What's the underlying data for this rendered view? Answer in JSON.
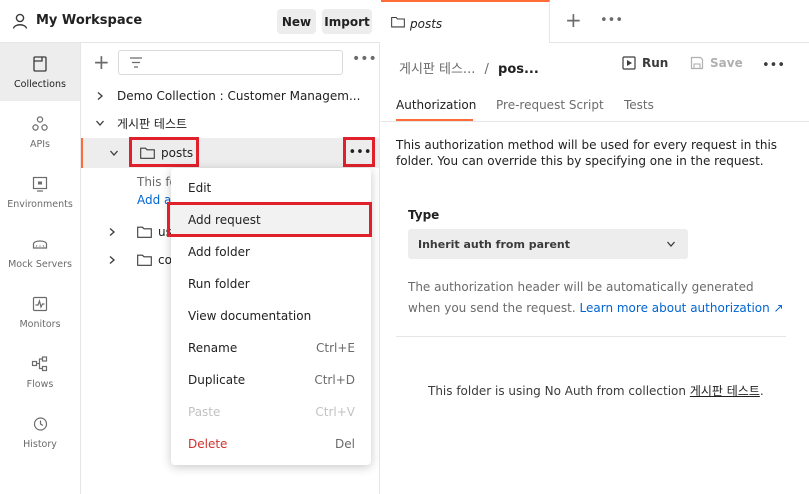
{
  "workspace": {
    "title": "My Workspace",
    "new_label": "New",
    "import_label": "Import"
  },
  "rail": {
    "items": [
      {
        "label": "Collections",
        "icon": "collections-icon"
      },
      {
        "label": "APIs",
        "icon": "apis-icon"
      },
      {
        "label": "Environments",
        "icon": "environments-icon"
      },
      {
        "label": "Mock Servers",
        "icon": "mock-servers-icon"
      },
      {
        "label": "Monitors",
        "icon": "monitors-icon"
      },
      {
        "label": "Flows",
        "icon": "flows-icon"
      },
      {
        "label": "History",
        "icon": "history-icon"
      }
    ]
  },
  "tree": {
    "more": "•••",
    "rows": [
      {
        "label": "Demo Collection : Customer Managem..."
      },
      {
        "label": "게시판 테스트"
      },
      {
        "label": "posts"
      },
      {
        "label": "us"
      },
      {
        "label": "co"
      }
    ],
    "empty_text": "This fol",
    "empty_link": "Add a"
  },
  "context_menu": {
    "items": [
      {
        "label": "Edit",
        "shortcut": ""
      },
      {
        "label": "Add request",
        "shortcut": ""
      },
      {
        "label": "Add folder",
        "shortcut": ""
      },
      {
        "label": "Run folder",
        "shortcut": ""
      },
      {
        "label": "View documentation",
        "shortcut": ""
      },
      {
        "label": "Rename",
        "shortcut": "Ctrl+E"
      },
      {
        "label": "Duplicate",
        "shortcut": "Ctrl+D"
      },
      {
        "label": "Paste",
        "shortcut": "Ctrl+V"
      },
      {
        "label": "Delete",
        "shortcut": "Del"
      }
    ]
  },
  "tabbar": {
    "tab_label": "posts",
    "plus": "+",
    "more": "•••"
  },
  "header": {
    "crumb_parent": "게시판 테스...",
    "crumb_sep": "/",
    "crumb_current": "pos...",
    "run_label": "Run",
    "save_label": "Save",
    "more": "•••"
  },
  "subtabs": {
    "authorization": "Authorization",
    "pre_request": "Pre-request Script",
    "tests": "Tests"
  },
  "auth": {
    "description": "This authorization method will be used for every request in this folder. You can override this by specifying one in the request.",
    "type_label": "Type",
    "type_value": "Inherit auth from parent",
    "note_text": "The authorization header will be automatically generated when you send the request. ",
    "note_link": "Learn more about authorization ↗",
    "noauth_text": "This folder is using No Auth from collection ",
    "noauth_link": "게시판 테스트",
    "noauth_end": "."
  },
  "colors": {
    "accent": "#ff6c37",
    "highlight_box": "#e0202b",
    "link": "#0265d2",
    "danger": "#d0312d"
  }
}
